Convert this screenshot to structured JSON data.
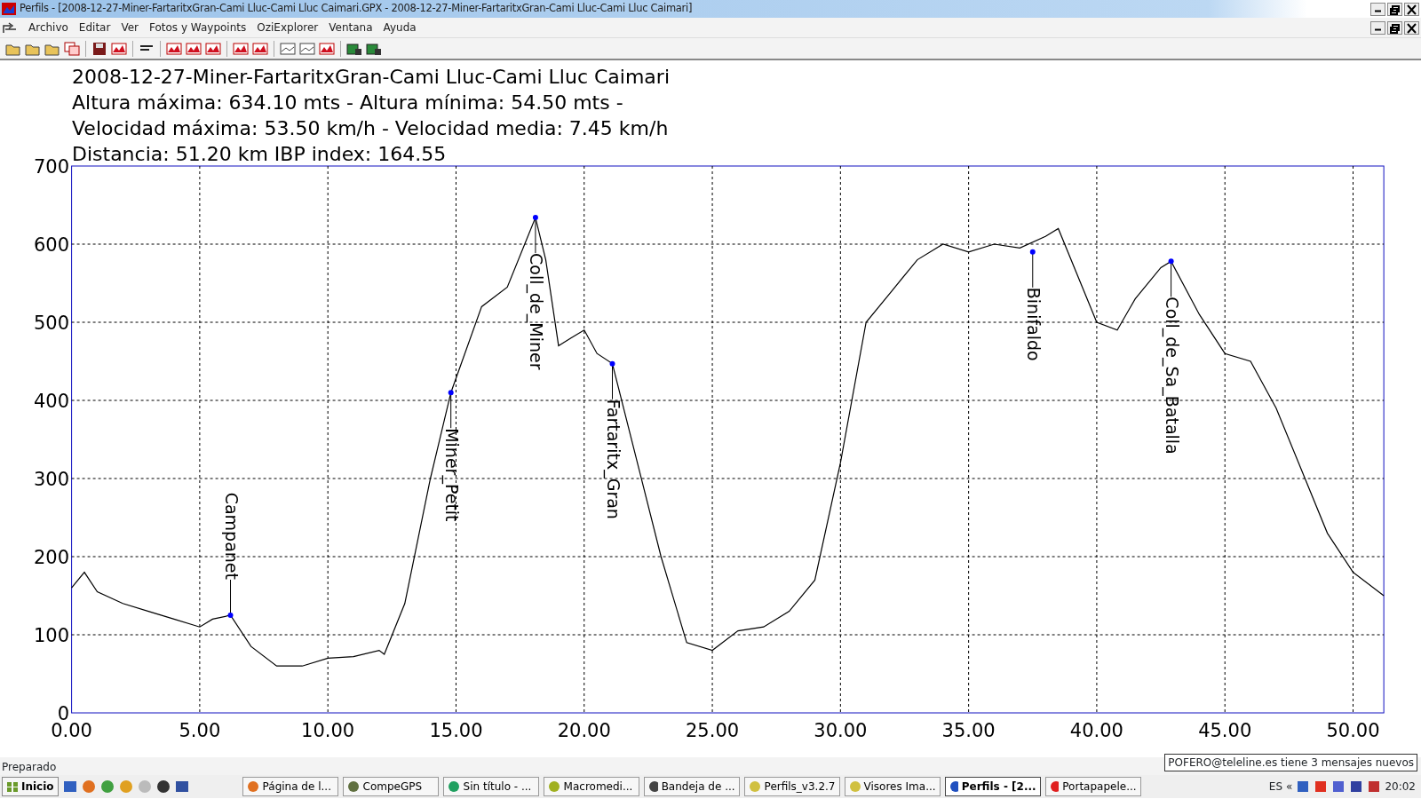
{
  "window": {
    "title": "Perfils - [2008-12-27-Miner-FartaritxGran-Cami Lluc-Cami Lluc Caimari.GPX - 2008-12-27-Miner-FartaritxGran-Cami Lluc-Cami Lluc Caimari]"
  },
  "menu": [
    "Archivo",
    "Editar",
    "Ver",
    "Fotos y Waypoints",
    "OziExplorer",
    "Ventana",
    "Ayuda"
  ],
  "profile": {
    "stats": [
      "Altura máxima: 634.10 mts - Altura mínima: 54.50 mts -",
      "Velocidad máxima: 53.50 km/h - Velocidad media: 7.45 km/h",
      "Distancia: 51.20 km IBP index: 164.55"
    ],
    "chart_data": {
      "type": "line",
      "title": "2008-12-27-Miner-FartaritxGran-Cami Lluc-Cami Lluc Caimari",
      "x": [
        0,
        0.5,
        1,
        2,
        3,
        4,
        5,
        5.5,
        6.2,
        7,
        8,
        9,
        10,
        11,
        12,
        12.2,
        13,
        14,
        14.8,
        16,
        17,
        18.1,
        18.5,
        19,
        19.5,
        20,
        20.5,
        21.1,
        22,
        23,
        24,
        25,
        26,
        27,
        28,
        29,
        30,
        31,
        32,
        33,
        34,
        35,
        36,
        37,
        38,
        38.5,
        40,
        40.8,
        41.5,
        42.5,
        42.9,
        44,
        45,
        46,
        47,
        48,
        49,
        50,
        51.2
      ],
      "grid": true,
      "series": [
        {
          "color": "#000000",
          "values": [
            160,
            180,
            155,
            140,
            130,
            120,
            110,
            120,
            125,
            85,
            60,
            60,
            70,
            72,
            80,
            75,
            140,
            300,
            410,
            520,
            545,
            634,
            580,
            470,
            480,
            490,
            460,
            447,
            330,
            200,
            90,
            80,
            105,
            110,
            130,
            170,
            320,
            500,
            540,
            580,
            600,
            590,
            600,
            595,
            610,
            620,
            500,
            490,
            530,
            570,
            578,
            510,
            460,
            450,
            390,
            310,
            230,
            180,
            150
          ]
        }
      ],
      "xlim": [
        0,
        51.2
      ],
      "ylim": [
        0,
        700
      ],
      "xticks": [
        {
          "value": 0,
          "label": "0.00"
        },
        {
          "value": 5,
          "label": "5.00"
        },
        {
          "value": 10,
          "label": "10.00"
        },
        {
          "value": 15,
          "label": "15.00"
        },
        {
          "value": 20,
          "label": "20.00"
        },
        {
          "value": 25,
          "label": "25.00"
        },
        {
          "value": 30,
          "label": "30.00"
        },
        {
          "value": 35,
          "label": "35.00"
        },
        {
          "value": 40,
          "label": "40.00"
        },
        {
          "value": 45,
          "label": "45.00"
        },
        {
          "value": 50,
          "label": "50.00"
        }
      ],
      "yticks": [
        0,
        100,
        200,
        300,
        400,
        500,
        600,
        700
      ],
      "annotations": [
        {
          "x": 6.2,
          "y": 125,
          "text": "Campanet"
        },
        {
          "x": 14.8,
          "y": 410,
          "text": "Miner_Petit"
        },
        {
          "x": 18.1,
          "y": 634,
          "text": "Coll_de_Miner"
        },
        {
          "x": 21.1,
          "y": 447,
          "text": "Fartaritx_Gran"
        },
        {
          "x": 37.5,
          "y": 590,
          "text": "Binifaldo"
        },
        {
          "x": 42.9,
          "y": 578,
          "text": "Coll_de_Sa_Batalla"
        }
      ]
    }
  },
  "status_bar": {
    "text": "Preparado"
  },
  "taskbar": {
    "start": "Inicio",
    "buttons": [
      {
        "label": "Página de l...",
        "selected": false
      },
      {
        "label": "CompeGPS",
        "selected": false
      },
      {
        "label": "Sin título - ...",
        "selected": false
      },
      {
        "label": "Macromedi...",
        "selected": false
      },
      {
        "label": "Bandeja de ...",
        "selected": false
      },
      {
        "label": "Perfils_v3.2.7",
        "selected": false
      },
      {
        "label": "Visores Ima...",
        "selected": false
      },
      {
        "label": "Perfils - [2...",
        "selected": true
      },
      {
        "label": "Portapapele...",
        "selected": false
      }
    ],
    "language": "ES",
    "expand": "«",
    "clock": "20:02",
    "notification": "POFERO@teleline.es tiene 3 mensajes nuevos"
  }
}
